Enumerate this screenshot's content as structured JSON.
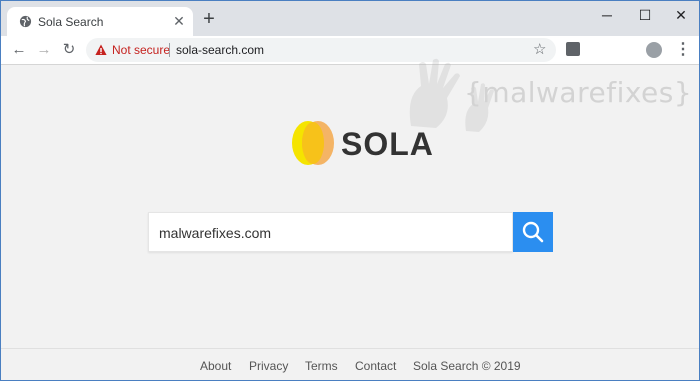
{
  "browser": {
    "tab_title": "Sola Search",
    "new_tab": "+",
    "window_controls": {
      "minimize": "─",
      "maximize": "☐",
      "close": "✕"
    }
  },
  "toolbar": {
    "back": "←",
    "forward": "→",
    "reload": "↻",
    "security_label": "Not secure",
    "url": "sola-search.com",
    "bookmark": "☆",
    "menu": "⋮"
  },
  "watermark": "{malwarefixes}",
  "logo": {
    "text": "SOLA"
  },
  "search": {
    "value": "malwarefixes.com",
    "button_color": "#2b8ef0"
  },
  "footer": {
    "about": "About",
    "privacy": "Privacy",
    "terms": "Terms",
    "contact": "Contact",
    "copyright": "Sola Search © 2019"
  },
  "colors": {
    "accent": "#2b8ef0",
    "warning": "#c5221f",
    "logo_yellow": "#f5c518",
    "logo_orange": "#f0a24a"
  }
}
